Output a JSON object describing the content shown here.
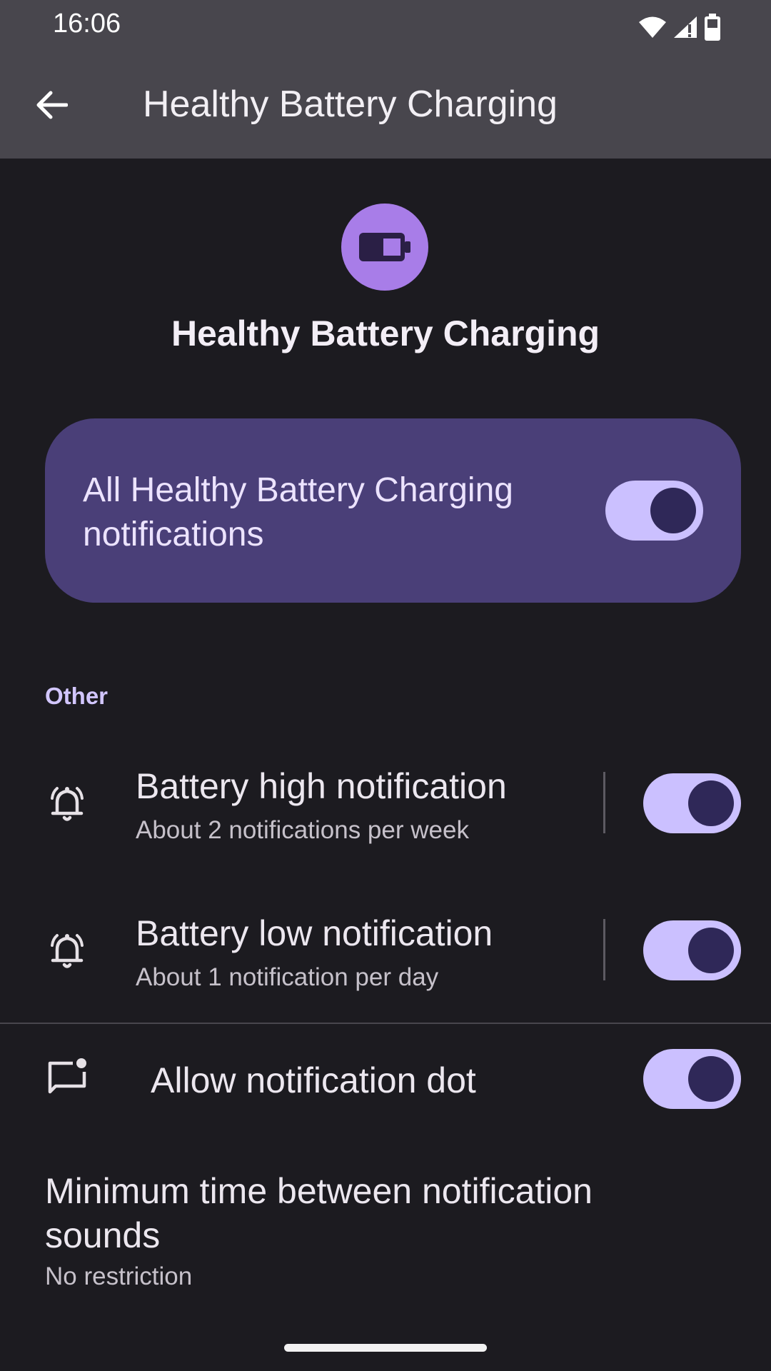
{
  "status_bar": {
    "time": "16:06",
    "icons": [
      "wifi-icon",
      "signal-icon",
      "battery-icon"
    ]
  },
  "app_bar": {
    "back_icon": "arrow-back-icon",
    "title": "Healthy Battery Charging"
  },
  "header": {
    "icon": "battery-icon",
    "title": "Healthy Battery Charging"
  },
  "master_toggle": {
    "label": "All Healthy Battery Charging notifications",
    "on": true
  },
  "section": {
    "title": "Other"
  },
  "channels": [
    {
      "icon": "bell-ringing-icon",
      "title": "Battery high notification",
      "subtitle": "About 2 notifications per week",
      "on": true
    },
    {
      "icon": "bell-ringing-icon",
      "title": "Battery low notification",
      "subtitle": "About 1 notification per day",
      "on": true
    }
  ],
  "notification_dot": {
    "icon": "notification-dot-icon",
    "title": "Allow notification dot",
    "on": true
  },
  "min_time": {
    "title": "Minimum time between notification sounds",
    "subtitle": "No restriction"
  },
  "colors": {
    "bars": "#48464d",
    "background": "#1c1b20",
    "card": "#4a3f78",
    "accent": "#cbc0ff",
    "app_icon": "#a87de8"
  }
}
